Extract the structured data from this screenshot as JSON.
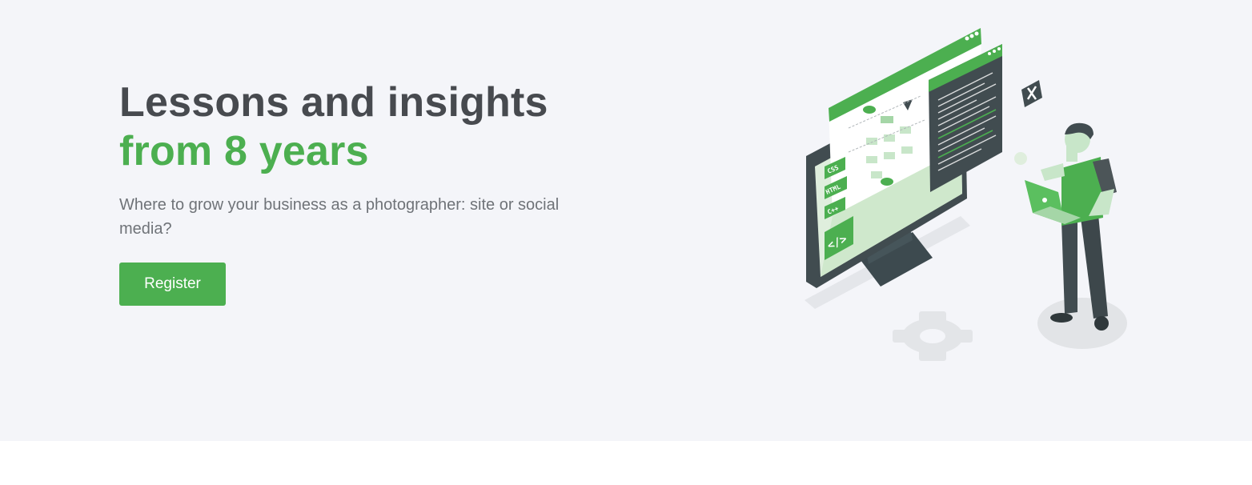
{
  "hero": {
    "headline_line1": "Lessons and insights",
    "headline_line2": "from 8 years",
    "subtitle": "Where to grow your business as a photographer: site or social media?",
    "cta_label": "Register"
  },
  "illustration": {
    "tags": [
      "CSS",
      "HTML",
      "C++"
    ],
    "code_icon": "</>"
  },
  "colors": {
    "accent": "#4caf50",
    "dark": "#414c50",
    "headline": "#474a4f",
    "background": "#f4f5f9"
  }
}
